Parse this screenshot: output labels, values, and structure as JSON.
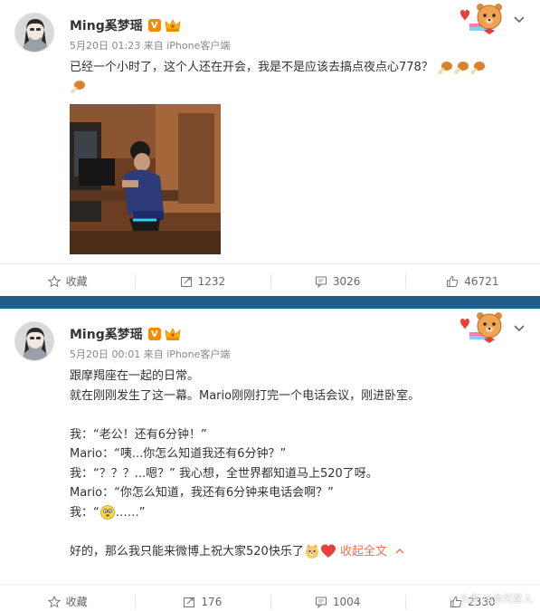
{
  "posts": [
    {
      "user": {
        "name": "Ming奚梦瑶",
        "badge": "V"
      },
      "meta": {
        "date": "5月20日 01:23",
        "source_prefix": "来自",
        "source": "iPhone客户端"
      },
      "text_lines": [
        "已经一个小时了，这个人还在开会，我是不是应该去搞点夜点心778？"
      ],
      "actions": {
        "collect": "收藏",
        "repost": "1232",
        "comment": "3026",
        "like": "46721"
      }
    },
    {
      "user": {
        "name": "Ming奚梦瑶",
        "badge": "V"
      },
      "meta": {
        "date": "5月20日 00:01",
        "source_prefix": "来自",
        "source": "iPhone客户端"
      },
      "text_lines": [
        "跟摩羯座在一起的日常。",
        "就在刚刚发生了这一幕。Mario刚刚打完一个电话会议，刚进卧室。",
        "",
        "我：“老公！还有6分钟！”",
        "Mario：“咦...你怎么知道我还有6分钟？”",
        "我：“？？？...嗯？” 我心想，全世界都知道马上520了呀。",
        "Mario：“你怎么知道，我还有6分钟来电话会啊？”",
        "我：“",
        "",
        "好的，那么我只能来微博上祝大家520快乐了"
      ],
      "ellipsis": "……”",
      "fold_label": "收起全文",
      "actions": {
        "collect": "收藏",
        "repost": "176",
        "comment": "1004",
        "like": "2330"
      }
    }
  ],
  "watermark": "头条 @余死星人",
  "colors": {
    "separator": "#1d5f86",
    "link": "#eb7350",
    "vip": "#f28b00"
  }
}
